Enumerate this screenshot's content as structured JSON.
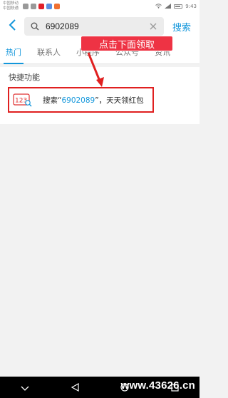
{
  "status_bar": {
    "carrier_line1": "中国移动",
    "carrier_line2": "中国联通",
    "time": "9:43"
  },
  "search": {
    "query": "6902089",
    "search_button": "搜索"
  },
  "tabs": [
    {
      "label": "热门"
    },
    {
      "label": "联系人"
    },
    {
      "label": "小程序"
    },
    {
      "label": "公众号"
    },
    {
      "label": "资讯"
    }
  ],
  "quick_section": {
    "title": "快捷功能",
    "item": {
      "icon_text": "123",
      "prefix": "搜索“",
      "highlight": "6902089",
      "suffix": "”，天天领红包"
    }
  },
  "annotation": {
    "text": "点击下面领取"
  },
  "watermark": {
    "text": "www.43626.cn"
  },
  "colors": {
    "accent": "#1296db",
    "highlight_box": "#e02020",
    "annotation_bg": "#ee3344"
  }
}
